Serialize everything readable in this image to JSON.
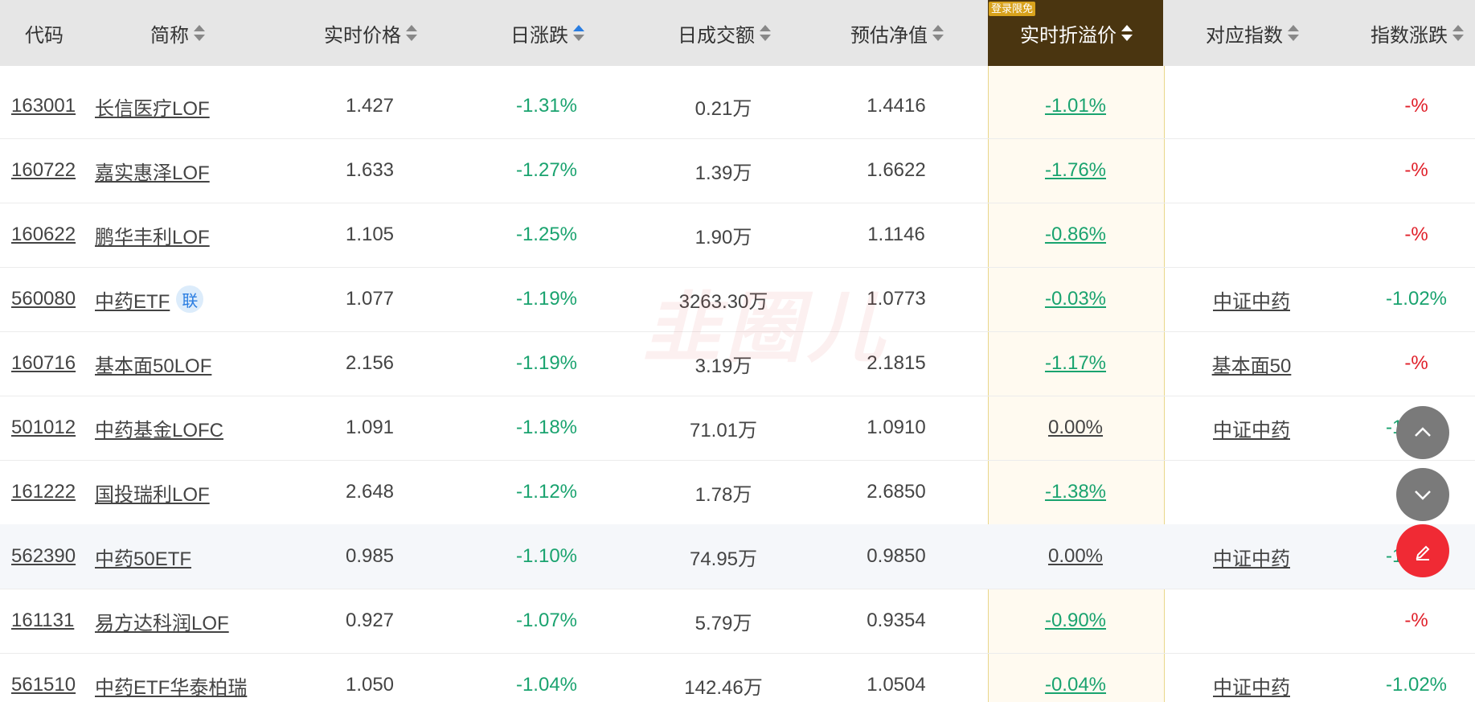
{
  "header": {
    "columns": [
      {
        "label": "代码"
      },
      {
        "label": "简称"
      },
      {
        "label": "实时价格"
      },
      {
        "label": "日涨跌"
      },
      {
        "label": "日成交额"
      },
      {
        "label": "预估净值"
      },
      {
        "label": "实时折溢价"
      },
      {
        "label": "对应指数"
      },
      {
        "label": "指数涨跌"
      }
    ],
    "badge": "登录限免"
  },
  "watermark": "韭圈儿",
  "rows": [
    {
      "code": "163001",
      "name": "长信医疗LOF",
      "tag": "",
      "price": "1.427",
      "change": "-1.31%",
      "volume": "0.21万",
      "nav": "1.4416",
      "premium": "-1.01%",
      "index": "",
      "index_change": "-%"
    },
    {
      "code": "160722",
      "name": "嘉实惠泽LOF",
      "tag": "",
      "price": "1.633",
      "change": "-1.27%",
      "volume": "1.39万",
      "nav": "1.6622",
      "premium": "-1.76%",
      "index": "",
      "index_change": "-%"
    },
    {
      "code": "160622",
      "name": "鹏华丰利LOF",
      "tag": "",
      "price": "1.105",
      "change": "-1.25%",
      "volume": "1.90万",
      "nav": "1.1146",
      "premium": "-0.86%",
      "index": "",
      "index_change": "-%"
    },
    {
      "code": "560080",
      "name": "中药ETF",
      "tag": "联",
      "price": "1.077",
      "change": "-1.19%",
      "volume": "3263.30万",
      "nav": "1.0773",
      "premium": "-0.03%",
      "index": "中证中药",
      "index_change": "-1.02%"
    },
    {
      "code": "160716",
      "name": "基本面50LOF",
      "tag": "",
      "price": "2.156",
      "change": "-1.19%",
      "volume": "3.19万",
      "nav": "2.1815",
      "premium": "-1.17%",
      "index": "基本面50",
      "index_change": "-%"
    },
    {
      "code": "501012",
      "name": "中药基金LOFC",
      "tag": "",
      "price": "1.091",
      "change": "-1.18%",
      "volume": "71.01万",
      "nav": "1.0910",
      "premium": "0.00%",
      "index": "中证中药",
      "index_change": "-1.02%"
    },
    {
      "code": "161222",
      "name": "国投瑞利LOF",
      "tag": "",
      "price": "2.648",
      "change": "-1.12%",
      "volume": "1.78万",
      "nav": "2.6850",
      "premium": "-1.38%",
      "index": "",
      "index_change": "-%"
    },
    {
      "code": "562390",
      "name": "中药50ETF",
      "tag": "",
      "price": "0.985",
      "change": "-1.10%",
      "volume": "74.95万",
      "nav": "0.9850",
      "premium": "0.00%",
      "index": "中证中药",
      "index_change": "-1.02%"
    },
    {
      "code": "161131",
      "name": "易方达科润LOF",
      "tag": "",
      "price": "0.927",
      "change": "-1.07%",
      "volume": "5.79万",
      "nav": "0.9354",
      "premium": "-0.90%",
      "index": "",
      "index_change": "-%"
    },
    {
      "code": "561510",
      "name": "中药ETF华泰柏瑞",
      "tag": "",
      "price": "1.050",
      "change": "-1.04%",
      "volume": "142.46万",
      "nav": "1.0504",
      "premium": "-0.04%",
      "index": "中证中药",
      "index_change": "-1.02%"
    }
  ],
  "colors": {
    "up": "#e0202a",
    "down": "#1aa36f",
    "highlight_header": "#4a3510",
    "badge": "#d8a21c",
    "fab": "#7a7a7a",
    "fab_edit": "#f02a34"
  },
  "icons": {
    "scroll_up": "chevron-up-icon",
    "scroll_down": "chevron-down-icon",
    "edit": "edit-icon",
    "sort": "sort-icon"
  }
}
